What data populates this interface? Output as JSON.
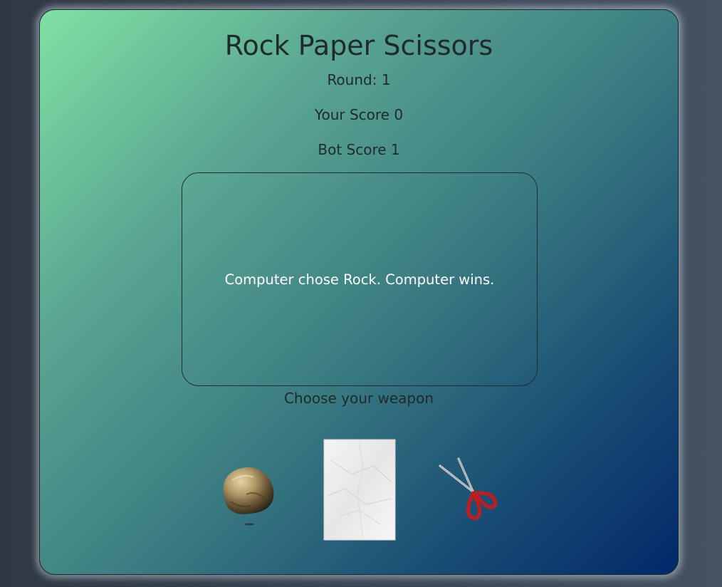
{
  "game": {
    "title": "Rock Paper Scissors",
    "round_text": "Round: 1",
    "player_score_text": "Your Score 0",
    "bot_score_text": "Bot Score 1",
    "result_text": "Computer chose Rock. Computer wins.",
    "prompt_text": "Choose your weapon"
  },
  "weapons": [
    {
      "name": "rock",
      "icon": "rock-icon"
    },
    {
      "name": "paper",
      "icon": "paper-icon"
    },
    {
      "name": "scissors",
      "icon": "scissors-icon"
    }
  ],
  "colors": {
    "card_gradient_start": "#7fe1a3",
    "card_gradient_end": "#02286a",
    "text_dark": "#1f2a2a",
    "result_text": "#ffffff",
    "page_background": "#3a4654"
  }
}
